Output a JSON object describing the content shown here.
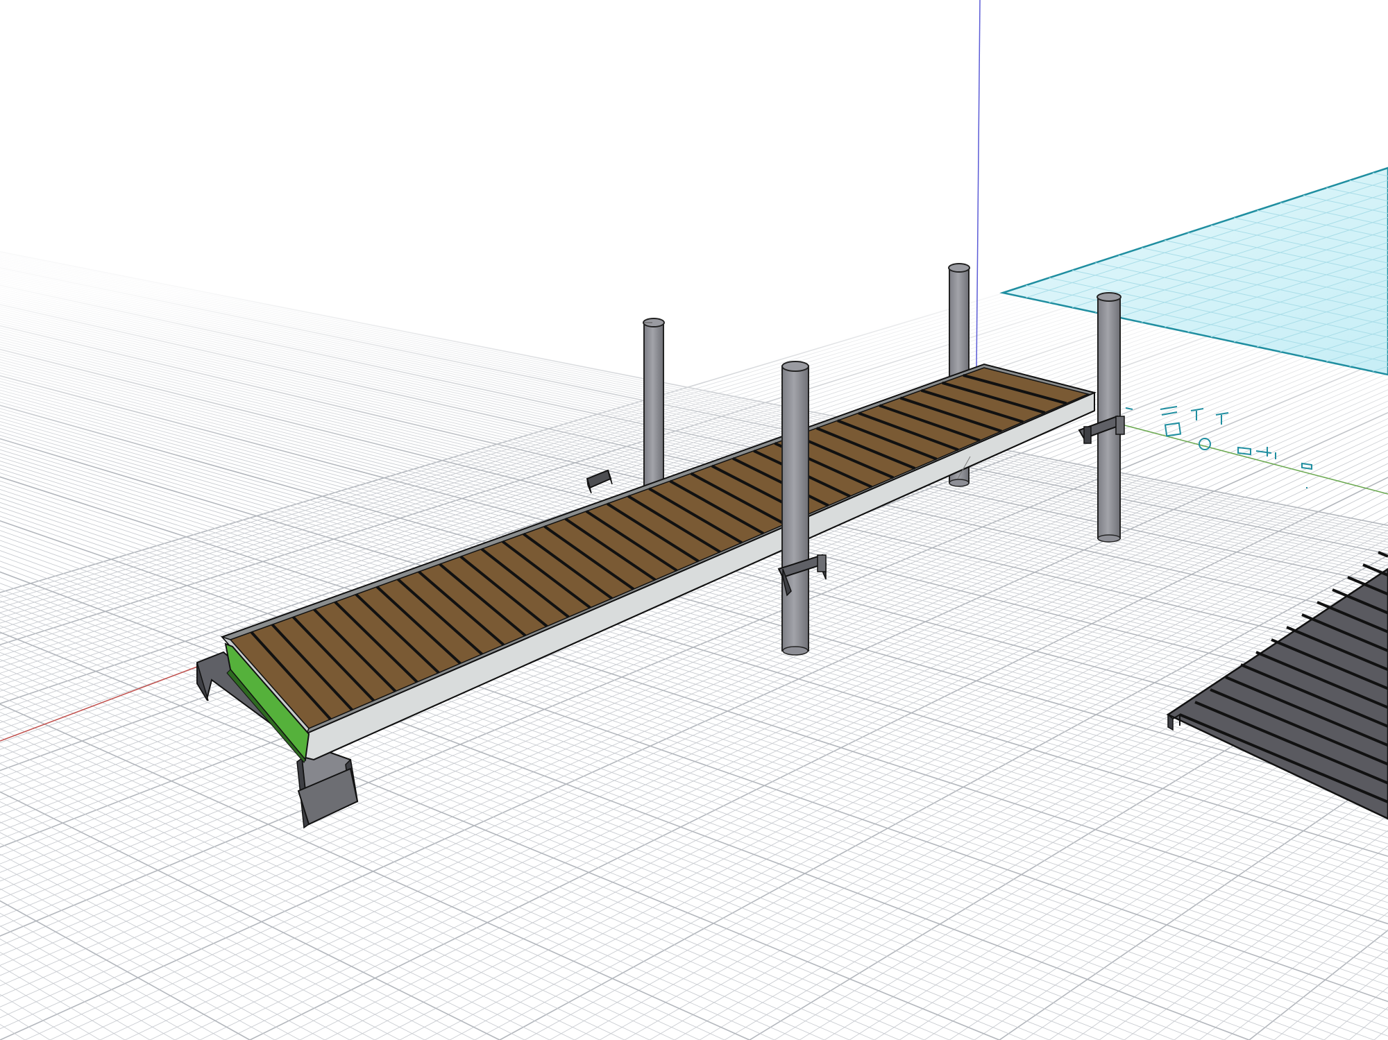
{
  "viewport": {
    "background": "#ffffff",
    "grid_color": "#c9ccd1",
    "grid_major_color": "#b3b7bd",
    "axis_colors": {
      "x_axis": "#c0504d",
      "y_axis": "#6aa84f",
      "z_axis": "#5b5bd6"
    }
  },
  "scene": {
    "objects": [
      {
        "name": "dock-section",
        "material_color": "#7a5a34",
        "board_gap_color": "#1a1a1a"
      },
      {
        "name": "dock-side-frame",
        "material_color": "#d9dcdc"
      },
      {
        "name": "dock-end-plate",
        "material_color": "#55b13b"
      },
      {
        "name": "gangway-bracket",
        "material_color": "#6d6e73"
      },
      {
        "name": "dock-posts",
        "material_color": "#8e8f96",
        "count": 4
      },
      {
        "name": "post-brackets",
        "material_color": "#6d6e73"
      },
      {
        "name": "separate-dark-dock-section",
        "material_color": "#5a5a60"
      },
      {
        "name": "water-plane",
        "material_color": "#d7f4fa",
        "edge_color": "#1f8ea0"
      }
    ]
  }
}
